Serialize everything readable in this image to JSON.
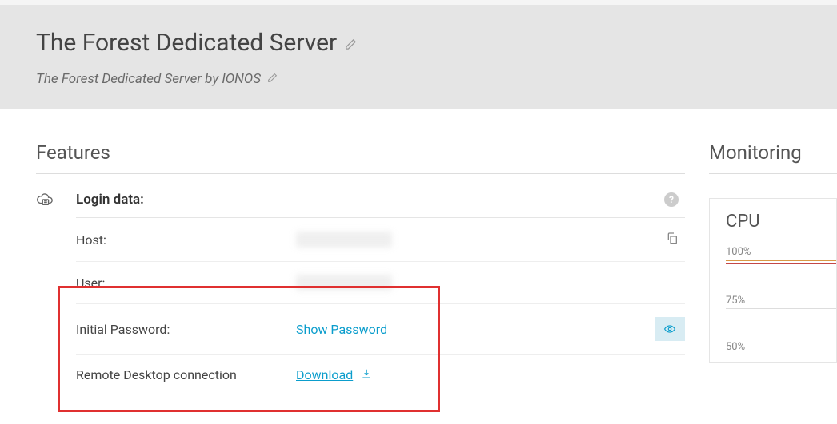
{
  "header": {
    "title": "The Forest Dedicated Server",
    "subtitle": "The Forest Dedicated Server by IONOS"
  },
  "features": {
    "title": "Features",
    "login_label": "Login data:",
    "rows": {
      "host": {
        "label": "Host:"
      },
      "user": {
        "label": "User:"
      },
      "password": {
        "label": "Initial Password:",
        "action": "Show Password"
      },
      "rdp": {
        "label": "Remote Desktop connection",
        "action": "Download"
      }
    }
  },
  "monitoring": {
    "title": "Monitoring",
    "cpu": {
      "title": "CPU",
      "ticks": [
        "100%",
        "75%",
        "50%"
      ]
    }
  }
}
